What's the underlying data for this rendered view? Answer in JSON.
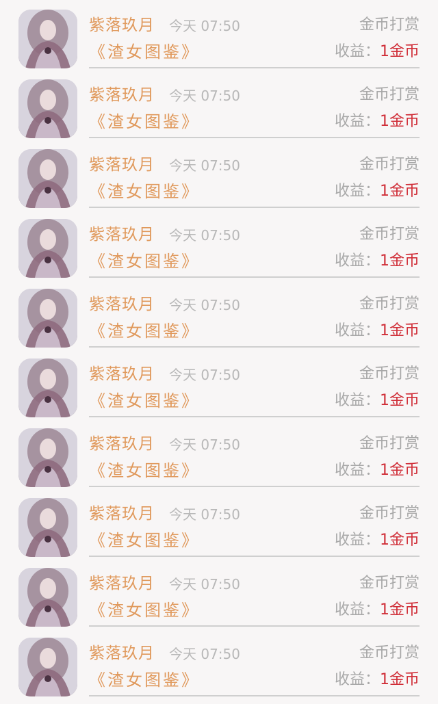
{
  "records": [
    {
      "user_name": "紫落玖月",
      "time": "今天 07:50",
      "reward_type": "金币打赏",
      "book_title": "《渣女图鉴》",
      "income_label": "收益：",
      "income_value": "1金币"
    },
    {
      "user_name": "紫落玖月",
      "time": "今天 07:50",
      "reward_type": "金币打赏",
      "book_title": "《渣女图鉴》",
      "income_label": "收益：",
      "income_value": "1金币"
    },
    {
      "user_name": "紫落玖月",
      "time": "今天 07:50",
      "reward_type": "金币打赏",
      "book_title": "《渣女图鉴》",
      "income_label": "收益：",
      "income_value": "1金币"
    },
    {
      "user_name": "紫落玖月",
      "time": "今天 07:50",
      "reward_type": "金币打赏",
      "book_title": "《渣女图鉴》",
      "income_label": "收益：",
      "income_value": "1金币"
    },
    {
      "user_name": "紫落玖月",
      "time": "今天 07:50",
      "reward_type": "金币打赏",
      "book_title": "《渣女图鉴》",
      "income_label": "收益：",
      "income_value": "1金币"
    },
    {
      "user_name": "紫落玖月",
      "time": "今天 07:50",
      "reward_type": "金币打赏",
      "book_title": "《渣女图鉴》",
      "income_label": "收益：",
      "income_value": "1金币"
    },
    {
      "user_name": "紫落玖月",
      "time": "今天 07:50",
      "reward_type": "金币打赏",
      "book_title": "《渣女图鉴》",
      "income_label": "收益：",
      "income_value": "1金币"
    },
    {
      "user_name": "紫落玖月",
      "time": "今天 07:50",
      "reward_type": "金币打赏",
      "book_title": "《渣女图鉴》",
      "income_label": "收益：",
      "income_value": "1金币"
    },
    {
      "user_name": "紫落玖月",
      "time": "今天 07:50",
      "reward_type": "金币打赏",
      "book_title": "《渣女图鉴》",
      "income_label": "收益：",
      "income_value": "1金币"
    },
    {
      "user_name": "紫落玖月",
      "time": "今天 07:50",
      "reward_type": "金币打赏",
      "book_title": "《渣女图鉴》",
      "income_label": "收益：",
      "income_value": "1金币"
    }
  ],
  "colors": {
    "background": "#f8f6f6",
    "accent_orange": "#e0995c",
    "coin_red": "#d02e38",
    "muted_gray": "#a8a8a8",
    "divider": "#cfcfcf"
  },
  "icons": {
    "avatar": "user-avatar-image"
  }
}
